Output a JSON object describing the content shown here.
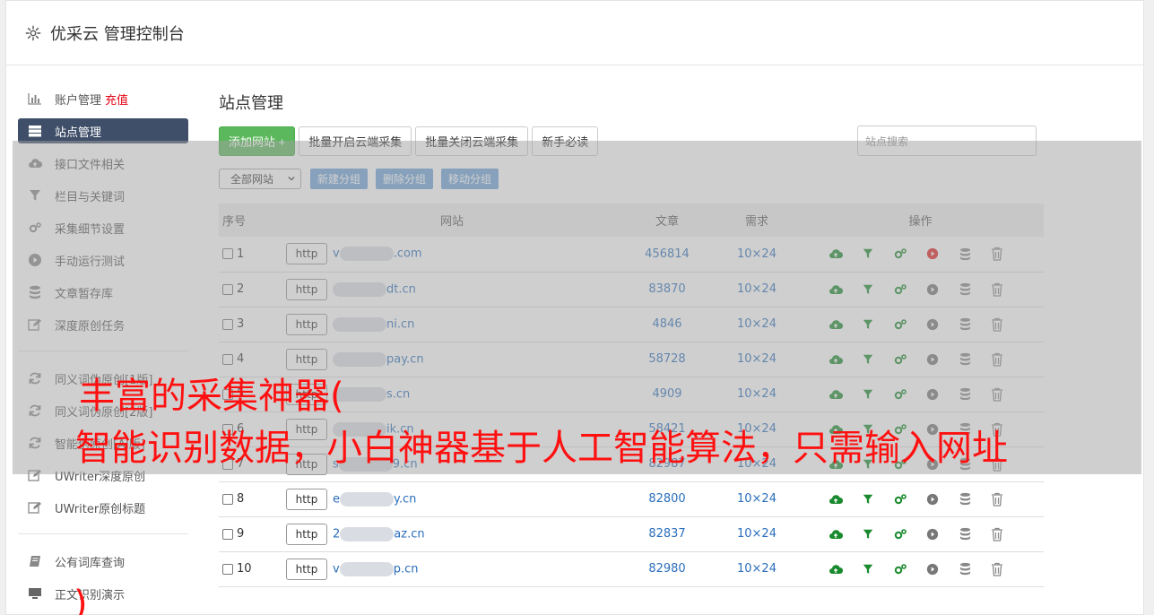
{
  "header": {
    "title": "优采云 管理控制台"
  },
  "sidebar": {
    "group1": [
      {
        "label": "账户管理",
        "extra": "充值",
        "icon": "bar-chart-icon"
      },
      {
        "label": "站点管理",
        "icon": "server-icon",
        "active": true
      },
      {
        "label": "接口文件相关",
        "icon": "cloud-upload-icon"
      },
      {
        "label": "栏目与关键词",
        "icon": "filter-icon"
      },
      {
        "label": "采集细节设置",
        "icon": "gears-icon"
      },
      {
        "label": "手动运行测试",
        "icon": "play-circle-icon"
      },
      {
        "label": "文章暂存库",
        "icon": "database-icon"
      },
      {
        "label": "深度原创任务",
        "icon": "edit-icon"
      }
    ],
    "group2": [
      {
        "label": "同义词伪原创[1版]",
        "icon": "refresh-icon"
      },
      {
        "label": "同义词伪原创[2版]",
        "icon": "refresh-icon"
      },
      {
        "label": "智能伪原创[AI版]",
        "icon": "refresh-icon"
      },
      {
        "label": "UWriter深度原创",
        "icon": "edit-icon"
      },
      {
        "label": "UWriter原创标题",
        "icon": "edit-icon"
      }
    ],
    "group3": [
      {
        "label": "公有词库查询",
        "icon": "book-icon"
      },
      {
        "label": "正文识别演示",
        "icon": "monitor-icon"
      }
    ]
  },
  "main": {
    "title": "站点管理",
    "toolbar": {
      "add_label": "添加网站 +",
      "enable_cloud_label": "批量开启云端采集",
      "disable_cloud_label": "批量关闭云端采集",
      "newbie_label": "新手必读",
      "search_placeholder": "站点搜索"
    },
    "toolbar2": {
      "group_select": "全部网站",
      "new_group": "新建分组",
      "delete_group": "删除分组",
      "move_group": "移动分组"
    },
    "table": {
      "headers": {
        "no": "序号",
        "site": "网站",
        "articles": "文章",
        "demand": "需求",
        "ops": "操作"
      },
      "rows": [
        {
          "no": "1",
          "prefix": "v",
          "suffix": ".com",
          "articles": "456814",
          "demand": "10×24",
          "run_active": true
        },
        {
          "no": "2",
          "prefix": "",
          "suffix": "dt.cn",
          "articles": "83870",
          "demand": "10×24"
        },
        {
          "no": "3",
          "prefix": "",
          "suffix": "ni.cn",
          "articles": "4846",
          "demand": "10×24"
        },
        {
          "no": "4",
          "prefix": "",
          "suffix": "pay.cn",
          "articles": "58728",
          "demand": "10×24"
        },
        {
          "no": "5",
          "prefix": "",
          "suffix": "s.cn",
          "articles": "4909",
          "demand": "10×24"
        },
        {
          "no": "6",
          "prefix": "",
          "suffix": "ik.cn",
          "articles": "58421",
          "demand": "10×24"
        },
        {
          "no": "7",
          "prefix": "s",
          "suffix": "9.cn",
          "articles": "82987",
          "demand": "10×24"
        },
        {
          "no": "8",
          "prefix": "e",
          "suffix": "y.cn",
          "articles": "82800",
          "demand": "10×24"
        },
        {
          "no": "9",
          "prefix": "2",
          "suffix": "az.cn",
          "articles": "82837",
          "demand": "10×24"
        },
        {
          "no": "10",
          "prefix": "v",
          "suffix": "p.cn",
          "articles": "82980",
          "demand": "10×24"
        }
      ],
      "http_label": "http"
    }
  },
  "overlay": {
    "line1": "丰富的采集神器(",
    "line2": "智能识别数据，小白神器基于人工智能算法，只需输入网址",
    "line3": ")"
  },
  "colors": {
    "sidebar_active": "#3f4f69",
    "green_button": "#5cb85c",
    "link_blue": "#2a6ebb",
    "overlay_text": "#ff1010",
    "accent_red": "#e60012"
  }
}
